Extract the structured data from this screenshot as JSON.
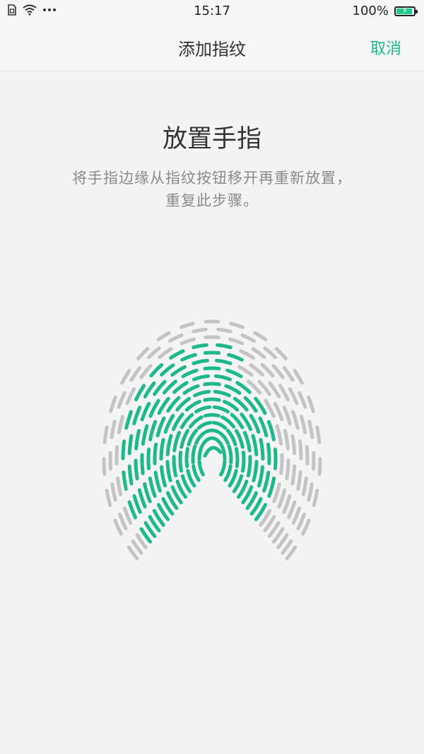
{
  "status_bar": {
    "time": "15:17",
    "battery_text": "100%",
    "battery_level": 1.0,
    "icons": [
      "sim-icon",
      "wifi-icon",
      "more-dots-icon",
      "battery-charging-icon"
    ]
  },
  "header": {
    "title": "添加指纹",
    "cancel_label": "取消"
  },
  "main": {
    "heading": "放置手指",
    "instruction": "将手指边缘从指纹按钮移开再重新放置，重复此步骤。"
  },
  "colors": {
    "accent": "#1db88b",
    "ridge_captured": "#1db88b",
    "ridge_pending": "#c4c4c4"
  },
  "fingerprint": {
    "icon": "fingerprint-icon",
    "enroll_progress": 0.8
  }
}
